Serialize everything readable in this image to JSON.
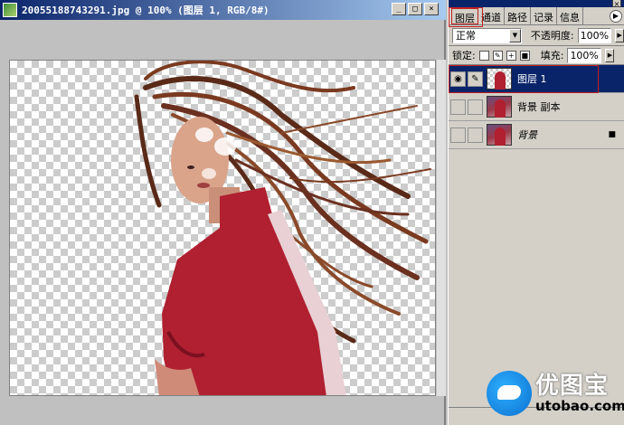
{
  "document": {
    "title": "20055188743291.jpg @ 100% (图层 1, RGB/8#)",
    "buttons": {
      "minimize": "_",
      "maximize": "□",
      "close": "×"
    }
  },
  "panel": {
    "close_glyph": "×",
    "tabs": [
      "图层",
      "通道",
      "路径",
      "记录",
      "信息"
    ],
    "active_tab": "图层",
    "tab_arrow": "▶",
    "blend_mode": "正常",
    "opacity_label": "不透明度:",
    "opacity_value": "100%",
    "lock_label": "锁定:",
    "lock_icons": [
      "transparency-lock-icon",
      "brush-lock-icon",
      "move-lock-icon",
      "padlock-icon"
    ],
    "fill_label": "填充:",
    "fill_value": "100%",
    "layers": [
      {
        "name": "图层 1",
        "visible": true,
        "selected": true,
        "linked_brush": true
      },
      {
        "name": "背景 副本",
        "visible": false,
        "selected": false
      },
      {
        "name": "背景",
        "visible": false,
        "selected": false,
        "locked": true,
        "italic": true
      }
    ]
  },
  "watermark": {
    "cn": "优图宝",
    "url": "utobao.com"
  },
  "colors": {
    "titlebar": "#0a246a",
    "selection": "#0a246a",
    "highlight": "#c02020",
    "shirt": "#b02030"
  }
}
